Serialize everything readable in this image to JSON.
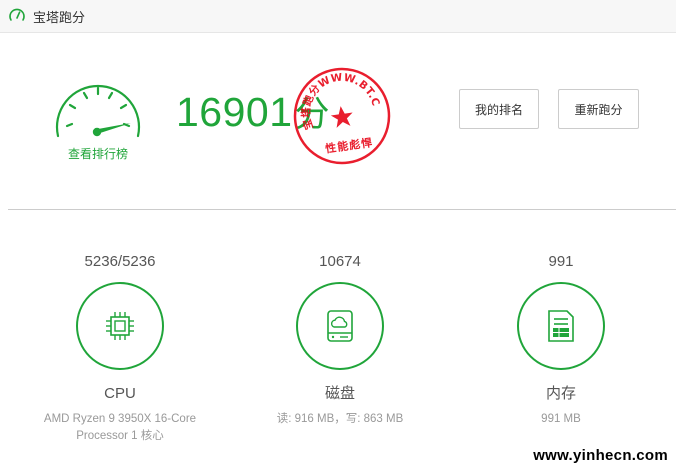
{
  "window": {
    "title": "宝塔跑分",
    "icon": "speedometer-icon"
  },
  "gauge": {
    "icon": "speedometer-gauge-icon",
    "link_label": "查看排行榜"
  },
  "score": {
    "value": "16901",
    "unit": "分"
  },
  "stamp": {
    "top_text": "宝塔跑分WWW.BT.CN",
    "bottom_text": "性能彪悍",
    "color": "#e60012"
  },
  "buttons": {
    "rank_label": "我的排名",
    "rerun_label": "重新跑分"
  },
  "metrics": [
    {
      "value": "5236/5236",
      "name": "CPU",
      "desc_line1": "AMD Ryzen 9 3950X 16-Core",
      "desc_line2": "Processor 1 核心",
      "icon": "cpu-chip-icon"
    },
    {
      "value": "10674",
      "name": "磁盘",
      "desc_line1": "读: 916 MB，写: 863 MB",
      "icon": "disk-drive-icon"
    },
    {
      "value": "991",
      "name": "内存",
      "desc_line1": "991 MB",
      "icon": "memory-icon"
    }
  ],
  "watermark": "www.yinhecn.com",
  "colors": {
    "accent": "#20a53a",
    "stamp": "#e60012",
    "border": "#cccccc"
  }
}
